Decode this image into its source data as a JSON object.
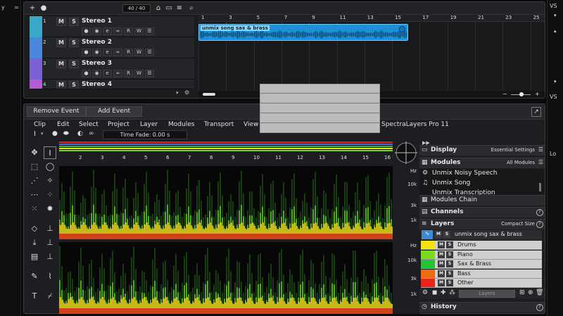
{
  "sidebars": {
    "left_labels": [
      "y",
      "="
    ],
    "right_labels": [
      "VS",
      "VS",
      "Lo"
    ]
  },
  "project": {
    "track_count": "40 / 40",
    "tracks": [
      {
        "num": "1",
        "name": "Stereo 1",
        "color": "#3aa9c9"
      },
      {
        "num": "2",
        "name": "Stereo 2",
        "color": "#4a86d9"
      },
      {
        "num": "3",
        "name": "Stereo 3",
        "color": "#7a62d6"
      },
      {
        "num": "4",
        "name": "Stereo 4",
        "color": "#b55bd4"
      }
    ],
    "mute_label": "M",
    "solo_label": "S",
    "read_label": "R",
    "write_label": "W",
    "ruler": [
      "1",
      "3",
      "5",
      "7",
      "9",
      "11",
      "13",
      "15",
      "17",
      "19",
      "21",
      "23",
      "25"
    ],
    "event_name": "unmix song sax & brass"
  },
  "spectralayers": {
    "remove_event": "Remove Event",
    "add_event": "Add Event",
    "menu": [
      "Clip",
      "Edit",
      "Select",
      "Project",
      "Layer",
      "Modules",
      "Transport",
      "View"
    ],
    "title": "SpectraLayers Pro 11",
    "time_fade": "Time Fade: 0.00 s",
    "ruler": [
      "2",
      "3",
      "4",
      "5",
      "6",
      "7",
      "8",
      "9",
      "10",
      "11",
      "12",
      "13",
      "14",
      "15",
      "16"
    ],
    "hz_labels": {
      "unit": "Hz",
      "top": [
        "10k",
        "3k",
        "1k"
      ],
      "bottom": [
        "10k",
        "3k",
        "1k"
      ]
    },
    "panels": {
      "display": {
        "title": "Display",
        "option": "Essential Settings"
      },
      "modules": {
        "title": "Modules",
        "option": "All Modules",
        "items": [
          "Unmix Noisy Speech",
          "Unmix Song",
          "Unmix Transcription"
        ]
      },
      "modules_chain": "Modules Chain",
      "channels": "Channels",
      "layers": {
        "title": "Layers",
        "option": "Compact Size",
        "parent": "unmix song sax & brass",
        "items": [
          {
            "name": "Drums",
            "color": "#f3e20e"
          },
          {
            "name": "Piano",
            "color": "#7bdc1b"
          },
          {
            "name": "Sax & Brass",
            "color": "#25c23a"
          },
          {
            "name": "Bass",
            "color": "#f06a10"
          },
          {
            "name": "Other",
            "color": "#e8231c"
          }
        ],
        "blend_mode": "Layers"
      },
      "history": "History"
    }
  }
}
